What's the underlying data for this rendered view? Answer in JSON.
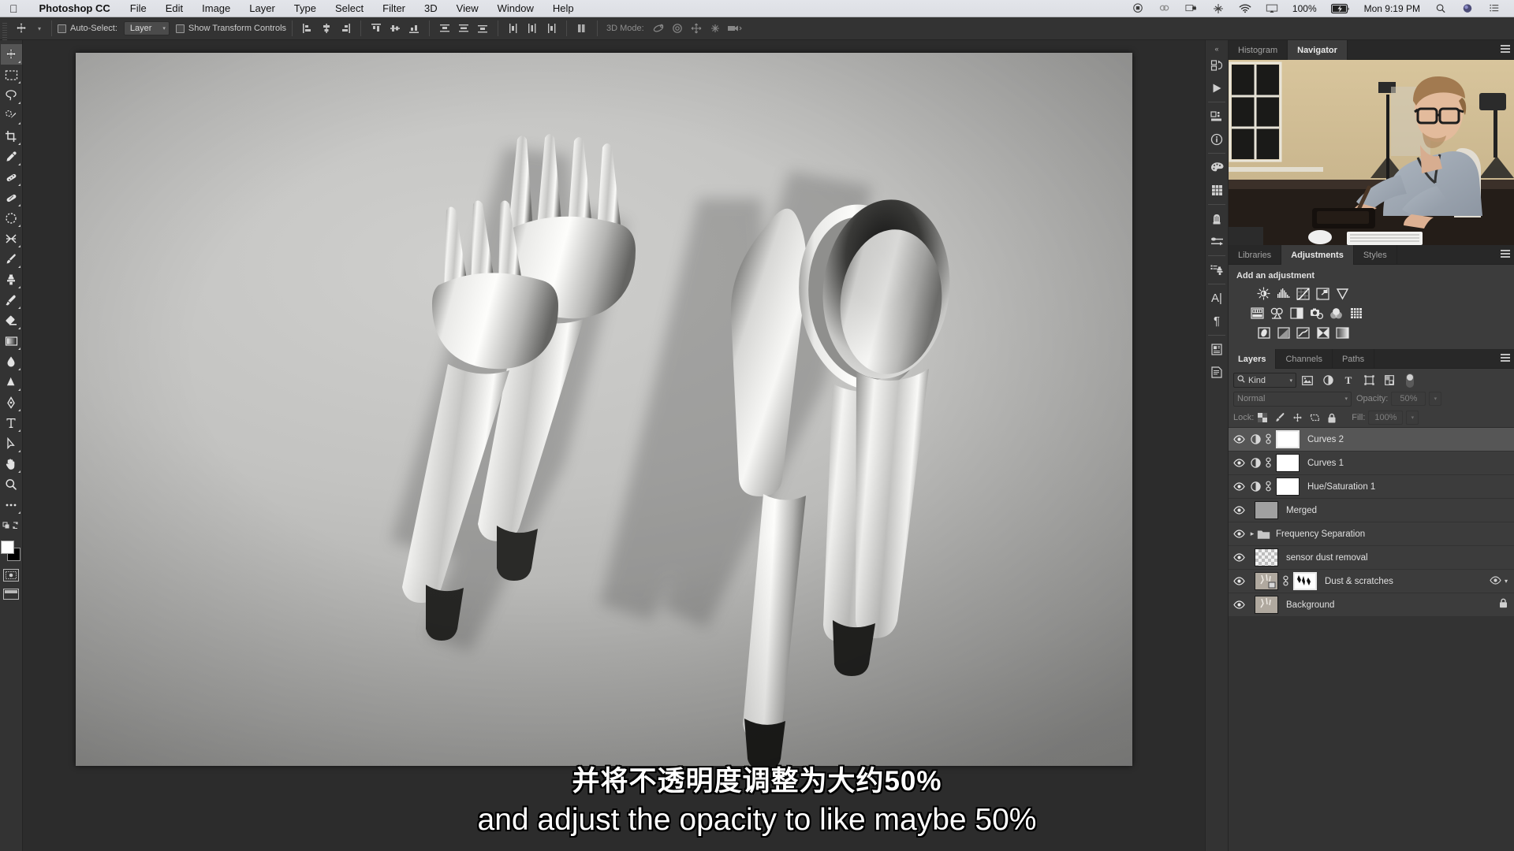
{
  "macbar": {
    "apple_icon": "apple-logo-icon",
    "app_name": "Photoshop CC",
    "menus": [
      "File",
      "Edit",
      "Image",
      "Layer",
      "Type",
      "Select",
      "Filter",
      "3D",
      "View",
      "Window",
      "Help"
    ],
    "status": {
      "record_icon": "screen-record-icon",
      "cc_icon": "creative-cloud-icon",
      "display_icon": "display-plug-icon",
      "dropbox_icon": "dropbox-sync-icon",
      "wifi_icon": "wifi-icon",
      "airplay_icon": "airplay-icon",
      "battery_percent": "100%",
      "battery_icon": "battery-charging-icon",
      "clock": "Mon 9:19 PM",
      "search_icon": "spotlight-search-icon",
      "siri_icon": "siri-icon",
      "notifications_icon": "notification-center-icon"
    }
  },
  "options_bar": {
    "tool_icon": "move-tool-icon",
    "preset_caret_icon": "chevron-down-icon",
    "auto_select_label": "Auto-Select:",
    "auto_select_checked": false,
    "auto_select_scope": "Layer",
    "show_transform_label": "Show Transform Controls",
    "show_transform_checked": false,
    "align_icons": [
      "align-left-edges-icon",
      "align-horizontal-centers-icon",
      "align-right-edges-icon",
      "align-top-edges-icon",
      "align-vertical-centers-icon",
      "align-bottom-edges-icon",
      "distribute-top-edges-icon",
      "distribute-vertical-centers-icon",
      "distribute-bottom-edges-icon",
      "distribute-left-edges-icon",
      "distribute-horizontal-centers-icon",
      "distribute-right-edges-icon"
    ],
    "more_icon": "align-more-options-icon",
    "mode_3d_label": "3D Mode:",
    "mode_3d_icons": [
      "orbit-3d-icon",
      "roll-3d-icon",
      "pan-3d-icon",
      "slide-3d-icon",
      "zoom-3d-camera-icon"
    ]
  },
  "toolbar": {
    "tools": [
      {
        "name": "move-tool",
        "icon": "move-cross-arrows-icon",
        "selected": true,
        "has_submenu": true
      },
      {
        "name": "rectangular-marquee-tool",
        "icon": "dashed-rectangle-icon",
        "selected": false,
        "has_submenu": true
      },
      {
        "name": "lasso-tool",
        "icon": "lasso-icon",
        "selected": false,
        "has_submenu": true
      },
      {
        "name": "quick-selection-tool",
        "icon": "quick-selection-brush-icon",
        "selected": false,
        "has_submenu": true
      },
      {
        "name": "crop-tool",
        "icon": "crop-frame-icon",
        "selected": false,
        "has_submenu": true
      },
      {
        "name": "eyedropper-tool",
        "icon": "eyedropper-icon",
        "selected": false,
        "has_submenu": true
      },
      {
        "name": "spot-healing-brush-tool",
        "icon": "spot-healing-bandage-icon",
        "selected": false,
        "has_submenu": true
      },
      {
        "name": "healing-brush-tool",
        "icon": "bandage-icon",
        "selected": false,
        "has_submenu": true
      },
      {
        "name": "patch-tool",
        "icon": "patch-dashed-blob-icon",
        "selected": false,
        "has_submenu": true
      },
      {
        "name": "content-aware-move-tool",
        "icon": "content-aware-move-icon",
        "selected": false,
        "has_submenu": true
      },
      {
        "name": "brush-tool",
        "icon": "paint-brush-icon",
        "selected": false,
        "has_submenu": true
      },
      {
        "name": "clone-stamp-tool",
        "icon": "clone-stamp-icon",
        "selected": false,
        "has_submenu": true
      },
      {
        "name": "history-brush-tool",
        "icon": "history-brush-icon",
        "selected": false,
        "has_submenu": true
      },
      {
        "name": "eraser-tool",
        "icon": "eraser-icon",
        "selected": false,
        "has_submenu": true
      },
      {
        "name": "gradient-tool",
        "icon": "gradient-swatch-icon",
        "selected": false,
        "has_submenu": true
      },
      {
        "name": "blur-tool",
        "icon": "water-drop-icon",
        "selected": false,
        "has_submenu": true
      },
      {
        "name": "dodge-tool",
        "icon": "dodge-burn-icon",
        "selected": false,
        "has_submenu": true
      },
      {
        "name": "pen-tool",
        "icon": "pen-nib-icon",
        "selected": false,
        "has_submenu": true
      },
      {
        "name": "type-tool",
        "icon": "type-T-icon",
        "selected": false,
        "has_submenu": true
      },
      {
        "name": "path-selection-tool",
        "icon": "path-arrow-icon",
        "selected": false,
        "has_submenu": true
      },
      {
        "name": "shape-tool",
        "icon": "rectangle-shape-icon",
        "selected": false,
        "has_submenu": true
      },
      {
        "name": "hand-tool",
        "icon": "hand-icon",
        "selected": false,
        "has_submenu": true
      },
      {
        "name": "zoom-tool",
        "icon": "magnifier-icon",
        "selected": false,
        "has_submenu": false
      },
      {
        "name": "edit-toolbar",
        "icon": "ellipsis-icon",
        "selected": false,
        "has_submenu": false
      }
    ],
    "swap_colors_icon": "swap-colors-arrow-icon",
    "default_colors_icon": "default-colors-icon",
    "foreground_color": "#ffffff",
    "background_color": "#000000",
    "quick_mask_icon": "quick-mask-icon",
    "screen_mode_icon": "screen-mode-icon"
  },
  "panels": {
    "top_group": {
      "tabs": [
        {
          "label": "Histogram",
          "active": false
        },
        {
          "label": "Navigator",
          "active": true
        }
      ],
      "menu_icon": "panel-menu-icon",
      "content": "video-overlay-instructor"
    },
    "adjustments_group": {
      "tabs": [
        {
          "label": "Libraries",
          "active": false
        },
        {
          "label": "Adjustments",
          "active": true
        },
        {
          "label": "Styles",
          "active": false
        }
      ],
      "menu_icon": "panel-menu-icon",
      "heading": "Add an adjustment",
      "buttons_row1": [
        "brightness-contrast-icon",
        "levels-icon",
        "curves-icon",
        "exposure-icon",
        "vibrance-icon"
      ],
      "buttons_row2": [
        "hue-saturation-icon",
        "color-balance-icon",
        "black-white-icon",
        "photo-filter-icon",
        "channel-mixer-icon",
        "color-lookup-icon"
      ],
      "buttons_row3": [
        "invert-icon",
        "posterize-icon",
        "threshold-icon",
        "selective-color-icon",
        "gradient-map-icon"
      ]
    },
    "layers_group": {
      "tabs": [
        {
          "label": "Layers",
          "active": true
        },
        {
          "label": "Channels",
          "active": false
        },
        {
          "label": "Paths",
          "active": false
        }
      ],
      "menu_icon": "panel-menu-icon",
      "filter": {
        "search_icon": "search-icon",
        "kind_label": "Kind",
        "caret_icon": "chevron-down-icon",
        "type_filters": [
          "filter-pixel-layers-icon",
          "filter-adjustment-layers-icon",
          "filter-type-layers-icon",
          "filter-shape-layers-icon",
          "filter-smart-objects-icon"
        ],
        "toggle_icon": "filter-enable-toggle"
      },
      "blend_mode": "Normal",
      "blend_caret_icon": "chevron-down-icon",
      "opacity_label": "Opacity:",
      "opacity_value": "50%",
      "opacity_stepper_icon": "chevron-down-icon",
      "lock_label": "Lock:",
      "lock_icons": [
        "lock-transparent-pixels-icon",
        "lock-image-pixels-icon",
        "lock-position-icon",
        "lock-artboard-nesting-icon",
        "lock-all-icon"
      ],
      "fill_label": "Fill:",
      "fill_value": "100%",
      "fill_stepper_icon": "chevron-down-icon",
      "layers": [
        {
          "name": "Curves 2",
          "visible": true,
          "selected": true,
          "kind": "adjustment",
          "thumb": "white-mask",
          "has_adjustment_icon": true,
          "has_link": true,
          "has_folder": false,
          "locked": false,
          "has_fx": false
        },
        {
          "name": "Curves 1",
          "visible": true,
          "selected": false,
          "kind": "adjustment",
          "thumb": "white-mask",
          "has_adjustment_icon": true,
          "has_link": true,
          "has_folder": false,
          "locked": false,
          "has_fx": false
        },
        {
          "name": "Hue/Saturation 1",
          "visible": true,
          "selected": false,
          "kind": "adjustment",
          "thumb": "white-mask",
          "has_adjustment_icon": true,
          "has_link": true,
          "has_folder": false,
          "locked": false,
          "has_fx": false
        },
        {
          "name": "Merged",
          "visible": true,
          "selected": false,
          "kind": "pixel",
          "thumb": "gray",
          "has_adjustment_icon": false,
          "has_link": false,
          "has_folder": false,
          "locked": false,
          "has_fx": false
        },
        {
          "name": "Frequency Separation",
          "visible": true,
          "selected": false,
          "kind": "group",
          "thumb": "folder",
          "has_adjustment_icon": false,
          "has_link": false,
          "has_folder": true,
          "locked": false,
          "has_fx": false
        },
        {
          "name": "sensor dust removal",
          "visible": true,
          "selected": false,
          "kind": "pixel",
          "thumb": "checker",
          "has_adjustment_icon": false,
          "has_link": false,
          "has_folder": false,
          "locked": false,
          "has_fx": false
        },
        {
          "name": "Dust & scratches",
          "visible": true,
          "selected": false,
          "kind": "smart-object",
          "thumb": "photo-with-mask",
          "has_adjustment_icon": false,
          "has_link": true,
          "has_folder": false,
          "locked": false,
          "has_fx": true,
          "fx_icon": "smart-filter-eye-icon",
          "expand_icon": "chevron-down-icon"
        },
        {
          "name": "Background",
          "visible": true,
          "selected": false,
          "kind": "pixel",
          "thumb": "photo",
          "has_adjustment_icon": false,
          "has_link": false,
          "has_folder": false,
          "locked": true,
          "lock_icon": "lock-icon",
          "has_fx": false
        }
      ]
    },
    "rail_icons": [
      "history-icon",
      "actions-play-icon",
      "properties-icon",
      "info-icon",
      "color-swatches-icon",
      "swatches-grid-icon",
      "brush-presets-icon",
      "brush-settings-icon",
      "clone-source-icon",
      "character-icon",
      "paragraph-icon",
      "character-styles-icon",
      "paragraph-styles-icon"
    ],
    "collapse_icon": "collapse-panels-icon"
  },
  "subtitles": {
    "chinese": "并将不透明度调整为大约50%",
    "english": "and adjust the opacity to like maybe 50%"
  },
  "colors": {
    "menubar_bg": "#e3e5ea",
    "panel_bg": "#3c3c3c",
    "chrome_bg": "#333333",
    "canvas_bg": "#2c2c2c",
    "selected_layer": "#565656",
    "text": "#e0e0e0"
  }
}
